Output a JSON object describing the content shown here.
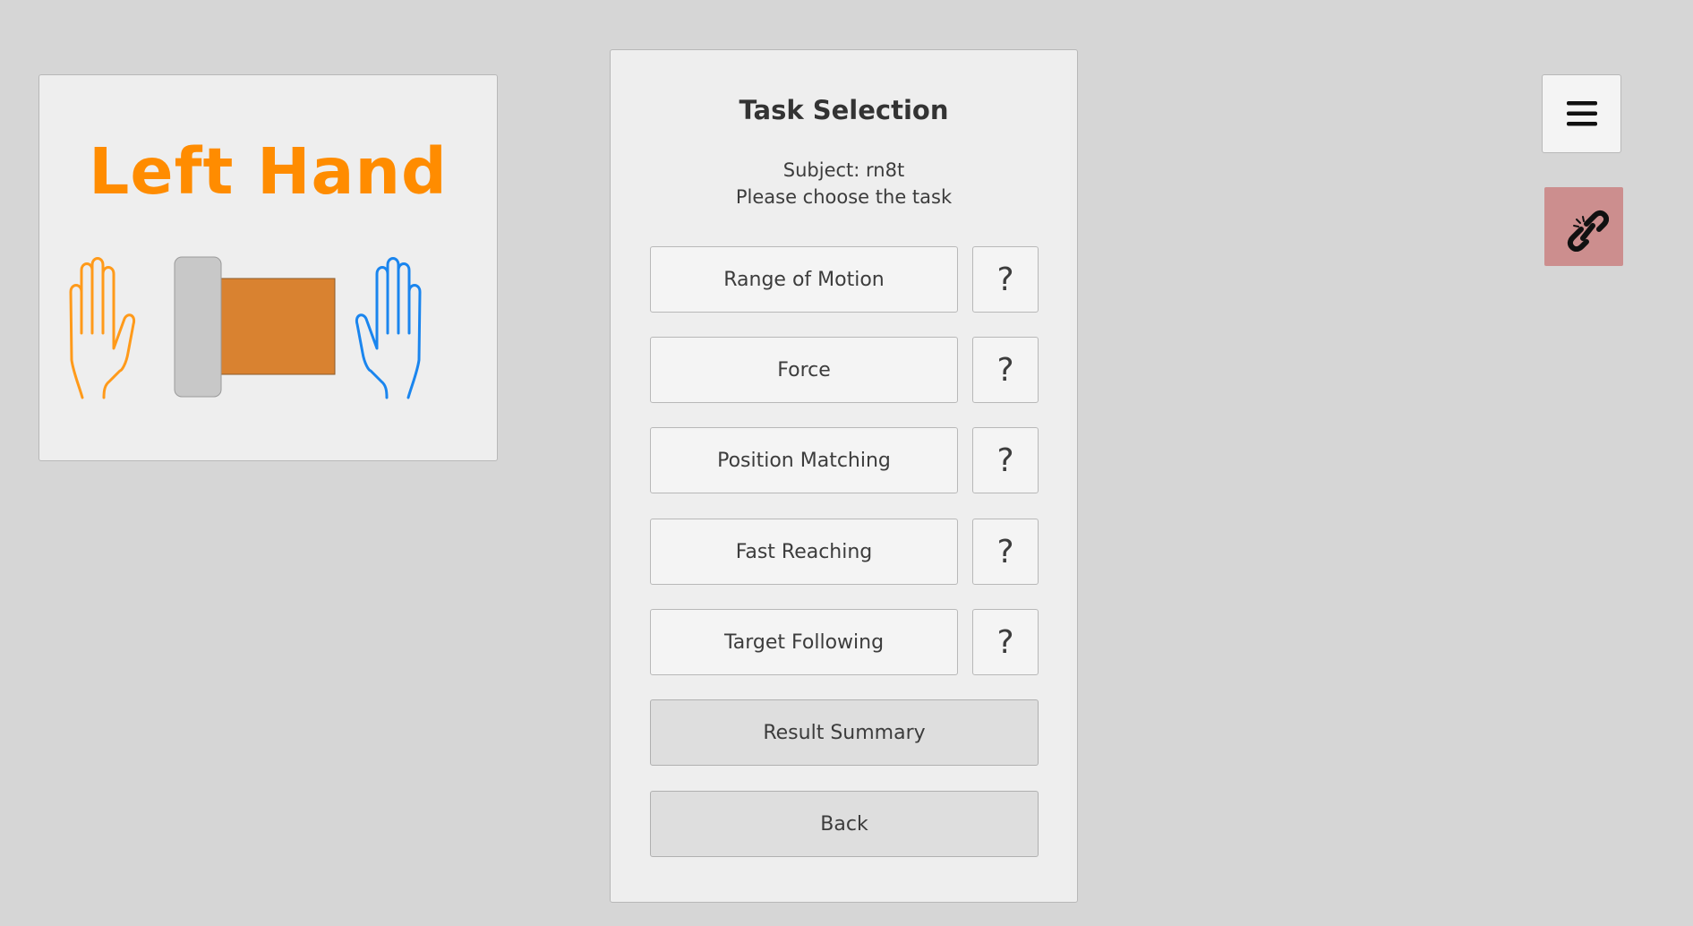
{
  "hand_panel": {
    "title": "Left Hand",
    "title_color": "#ff8c00",
    "left_hand_color": "#ff9a1a",
    "right_hand_color": "#1a85ee",
    "device_color": "#d98230",
    "device_handle_color": "#c8c8c8",
    "icons": [
      "left-hand-outline-icon",
      "hand-device-icon",
      "right-hand-outline-icon"
    ]
  },
  "task_panel": {
    "title": "Task Selection",
    "subject_text": "Subject: rn8t",
    "instruction": "Please choose the task",
    "tasks": [
      {
        "label": "Range of Motion",
        "help": "?"
      },
      {
        "label": "Force",
        "help": "?"
      },
      {
        "label": "Position Matching",
        "help": "?"
      },
      {
        "label": "Fast Reaching",
        "help": "?"
      },
      {
        "label": "Target Following",
        "help": "?"
      }
    ],
    "result_summary_label": "Result Summary",
    "back_label": "Back"
  },
  "toolbar": {
    "menu_icon": "hamburger-menu-icon",
    "link_icon": "broken-link-icon",
    "link_button_color": "#cc8e8e"
  }
}
